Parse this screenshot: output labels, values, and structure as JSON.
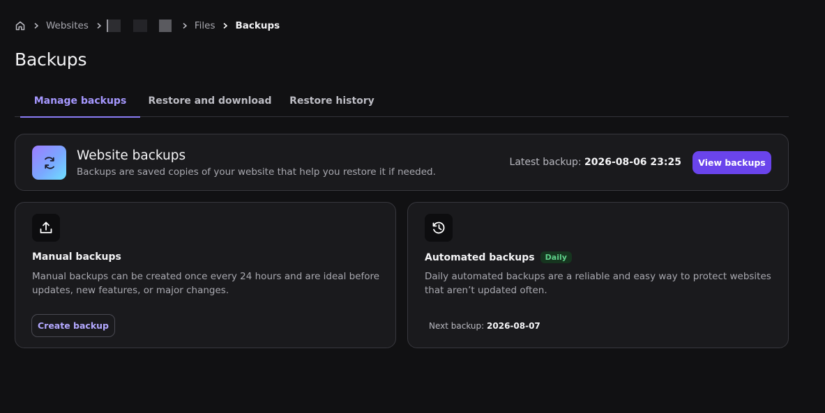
{
  "breadcrumb": {
    "items": [
      "Websites",
      "Files"
    ],
    "current": "Backups"
  },
  "page": {
    "title": "Backups"
  },
  "tabs": [
    {
      "label": "Manage backups",
      "active": true
    },
    {
      "label": "Restore and download",
      "active": false
    },
    {
      "label": "Restore history",
      "active": false
    }
  ],
  "banner": {
    "icon": "refresh-icon",
    "title": "Website backups",
    "description": "Backups are saved copies of your website that help you restore it if needed.",
    "latest_label": "Latest backup:",
    "latest_value": "2026-08-06 23:25",
    "button_label": "View backups"
  },
  "manual": {
    "icon": "upload-icon",
    "title": "Manual backups",
    "description": "Manual backups can be created once every 24 hours and are ideal before updates, new features, or major changes.",
    "button_label": "Create backup"
  },
  "automated": {
    "icon": "history-icon",
    "title": "Automated backups",
    "badge": "Daily",
    "description": "Daily automated backups are a reliable and easy way to protect websites that aren’t updated often.",
    "next_label": "Next backup:",
    "next_value": "2026-08-07"
  },
  "colors": {
    "background": "#111113",
    "card": "#1a1a1d",
    "accent": "#6a44ec",
    "tab_active": "#a698ff",
    "badge_text": "#5fd18a"
  }
}
